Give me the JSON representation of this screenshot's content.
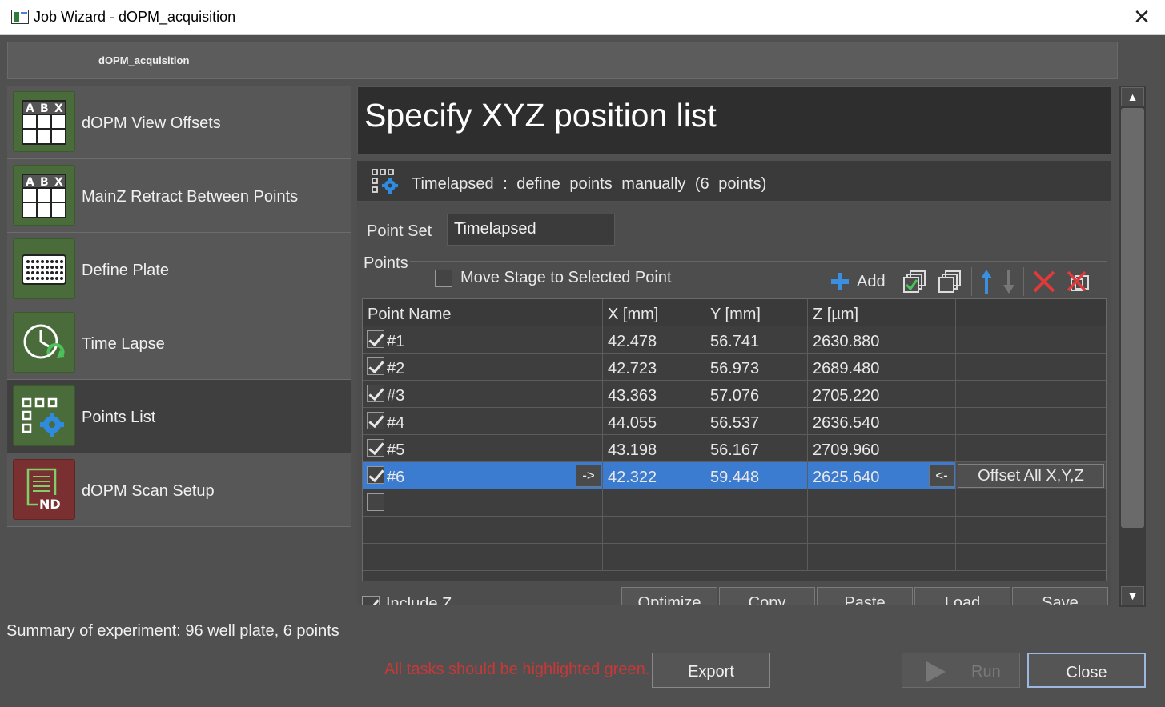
{
  "window": {
    "title": "Job Wizard - dOPM_acquisition",
    "close_glyph": "✕"
  },
  "header": {
    "job_name": "dOPM_acquisition"
  },
  "tasks": [
    {
      "label": "dOPM View Offsets",
      "icon": "abx-grid-icon"
    },
    {
      "label": "MainZ Retract Between Points",
      "icon": "abx-grid-icon"
    },
    {
      "label": "Define Plate",
      "icon": "well-plate-icon"
    },
    {
      "label": "Time Lapse",
      "icon": "clock-refresh-icon"
    },
    {
      "label": "Points List",
      "icon": "points-gear-icon"
    },
    {
      "label": "dOPM Scan Setup",
      "icon": "nd-document-icon",
      "nd_text": "ND"
    }
  ],
  "abx_letters": [
    "A",
    "B",
    "X"
  ],
  "main": {
    "title": "Specify XYZ position list",
    "section": "Timelapsed : define points manually (6 points)",
    "point_set_label": "Point Set",
    "point_set_value": "Timelapsed",
    "points_label": "Points",
    "move_stage_label": "Move Stage to Selected Point",
    "add_label": "Add",
    "include_z_label": "Include Z",
    "columns": [
      "Point Name",
      "X [mm]",
      "Y [mm]",
      "Z [µm]",
      ""
    ],
    "rows": [
      {
        "name": "#1",
        "x": "42.478",
        "y": "56.741",
        "z": "2630.880",
        "checked": true
      },
      {
        "name": "#2",
        "x": "42.723",
        "y": "56.973",
        "z": "2689.480",
        "checked": true
      },
      {
        "name": "#3",
        "x": "43.363",
        "y": "57.076",
        "z": "2705.220",
        "checked": true
      },
      {
        "name": "#4",
        "x": "44.055",
        "y": "56.537",
        "z": "2636.540",
        "checked": true
      },
      {
        "name": "#5",
        "x": "43.198",
        "y": "56.167",
        "z": "2709.960",
        "checked": true
      },
      {
        "name": "#6",
        "x": "42.322",
        "y": "59.448",
        "z": "2625.640",
        "checked": true
      }
    ],
    "arrow_right": "->",
    "arrow_left": "<-",
    "offset_all": "Offset All X,Y,Z",
    "bottom_buttons": [
      "Optimize",
      "Copy",
      "Paste",
      "Load",
      "Save"
    ]
  },
  "footer": {
    "summary": "Summary of experiment: 96 well plate, 6 points",
    "warning": "All tasks should be highlighted green.",
    "export": "Export",
    "run": "Run",
    "close": "Close"
  },
  "colors": {
    "selection": "#3b7bd0",
    "warning": "#c83838",
    "task_tile_green": "#4a6b3a",
    "task_tile_red": "#7a3030",
    "accent_blue": "#3a8fe0"
  }
}
